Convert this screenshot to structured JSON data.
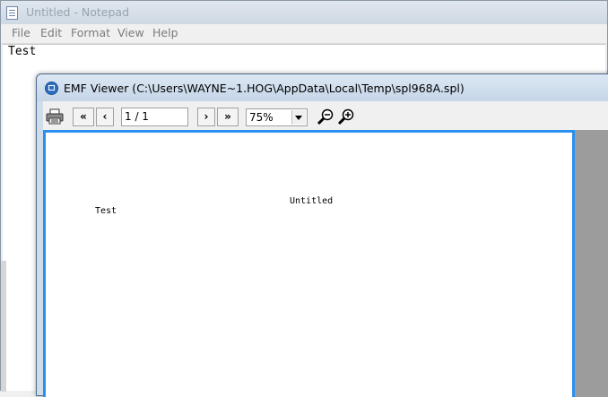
{
  "notepad": {
    "title": "Untitled - Notepad",
    "menu": [
      "File",
      "Edit",
      "Format",
      "View",
      "Help"
    ],
    "content": "Test"
  },
  "emf_viewer": {
    "title": "EMF Viewer (C:\\Users\\WAYNE~1.HOG\\AppData\\Local\\Temp\\spl968A.spl)",
    "toolbar": {
      "first_label": "«",
      "prev_label": "‹",
      "page_indicator": "1 / 1",
      "next_label": "›",
      "last_label": "»",
      "zoom_value": "75%"
    },
    "page": {
      "header": "Untitled",
      "body": "Test"
    }
  },
  "icons": {
    "notepad": "notepad-icon",
    "emf": "emf-viewer-icon",
    "print": "printer-icon",
    "zoom_out": "zoom-out-icon",
    "zoom_in": "zoom-in-icon"
  },
  "colors": {
    "page_border": "#2b8ff0",
    "view_background": "#9c9c9c"
  }
}
